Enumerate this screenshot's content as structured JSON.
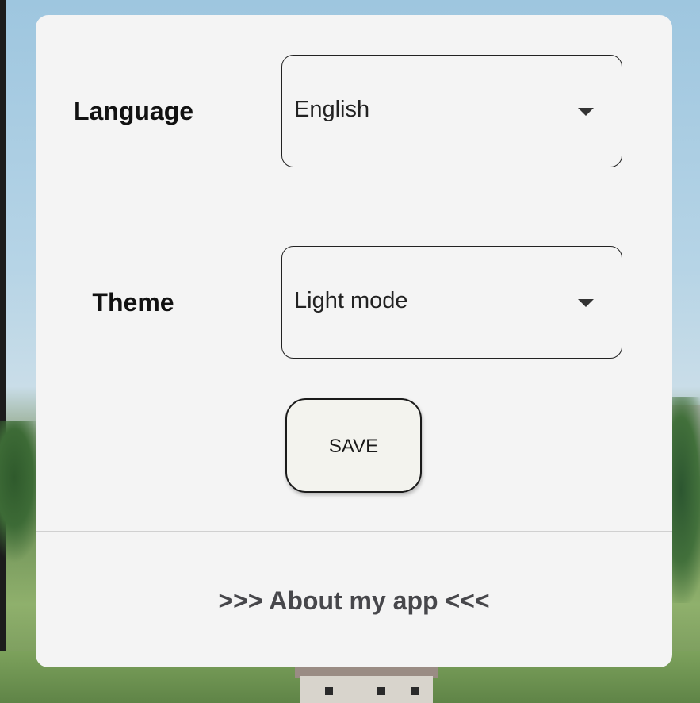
{
  "settings": {
    "language": {
      "label": "Language",
      "selected": "English"
    },
    "theme": {
      "label": "Theme",
      "selected": "Light mode"
    },
    "save_label": "SAVE",
    "about_link": ">>> About my app <<<"
  },
  "icons": {
    "dropdown": "caret-down-icon"
  }
}
